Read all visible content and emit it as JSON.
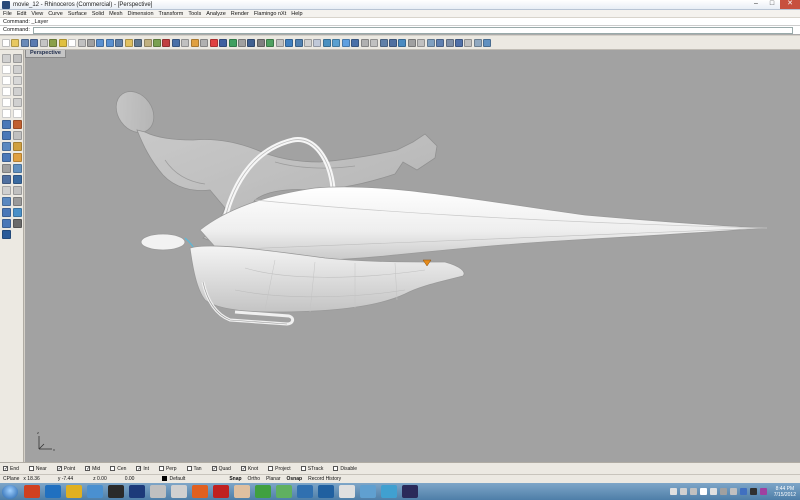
{
  "window": {
    "title": "movie_12 - Rhinoceros (Commercial) - [Perspective]",
    "controls": [
      "–",
      "□",
      "✕"
    ]
  },
  "menu": [
    "File",
    "Edit",
    "View",
    "Curve",
    "Surface",
    "Solid",
    "Mesh",
    "Dimension",
    "Transform",
    "Tools",
    "Analyze",
    "Render",
    "Flamingo nXt",
    "Help"
  ],
  "command": {
    "history": "Command: _Layer",
    "prompt": "Command:",
    "value": ""
  },
  "toolbar_colors": [
    "#ffffff",
    "#e8c860",
    "#6a8ab8",
    "#5a7ab0",
    "#c4c4c4",
    "#8aa04a",
    "#e0c040",
    "#ffffff",
    "#c0c0c0",
    "#a0a0a0",
    "#5a90d0",
    "#5a90d0",
    "#6080a8",
    "#e0c060",
    "#607890",
    "#c0b080",
    "#7aa050",
    "#c04040",
    "#4a70a8",
    "#c0c0c0",
    "#e0a040",
    "#b0b0b0",
    "#e04040",
    "#4060a0",
    "#40a060",
    "#a0a0a0",
    "#406090",
    "#808080",
    "#50a060",
    "#c0c0c0",
    "#4080c0",
    "#5080b0",
    "#d0d0d0",
    "#c0c8d8",
    "#4a90c0",
    "#5aa0d0",
    "#60a0e0",
    "#4a70a8",
    "#b0b0b0",
    "#c0c0c0",
    "#6080a8",
    "#5070a0",
    "#4a8ac0",
    "#a0a0a0",
    "#c0c0c0",
    "#80a0c0",
    "#6080b0",
    "#8090a8",
    "#5070a8",
    "#c0c0c0",
    "#90a8c0",
    "#6090c0"
  ],
  "viewport": {
    "tab": "Perspective",
    "background": "#a2a2a2"
  },
  "osnaps": [
    {
      "label": "End",
      "checked": true
    },
    {
      "label": "Near",
      "checked": false
    },
    {
      "label": "Point",
      "checked": true
    },
    {
      "label": "Mid",
      "checked": true
    },
    {
      "label": "Cen",
      "checked": false
    },
    {
      "label": "Int",
      "checked": true
    },
    {
      "label": "Perp",
      "checked": false
    },
    {
      "label": "Tan",
      "checked": false
    },
    {
      "label": "Quad",
      "checked": true
    },
    {
      "label": "Knot",
      "checked": true
    },
    {
      "label": "Project",
      "checked": false
    },
    {
      "label": "STrack",
      "checked": false
    },
    {
      "label": "Disable",
      "checked": false
    }
  ],
  "status": {
    "plane": "CPlane",
    "x": "x 18.36",
    "y": "y -7.44",
    "z": "z 0.00",
    "units": "0.00",
    "layer": "Default",
    "buttons": [
      "Snap",
      "Ortho",
      "Planar",
      "Osnap",
      "Record History"
    ]
  },
  "taskbar": {
    "apps": [
      "#d04020",
      "#2070c0",
      "#e0b020",
      "#4a90d0",
      "#2a2a2a",
      "#1c3a7a",
      "#c0c0c0",
      "#d0d0d0",
      "#e06020",
      "#c02020",
      "#e0c0a0",
      "#40a040",
      "#60b060",
      "#3070b0",
      "#2060a0",
      "#e0e0e0",
      "#60a0d0",
      "#40a0d0",
      "#2a2a5a"
    ],
    "tray": [
      "#a040a0",
      "#303030",
      "#4070c0",
      "#c0c0c0",
      "#a0a0a0",
      "#e0e0e0",
      "#ffffff",
      "#c0c0c0",
      "#d0d0d0",
      "#e0e0e0"
    ],
    "time": "8:44 PM",
    "date": "7/15/2012"
  }
}
